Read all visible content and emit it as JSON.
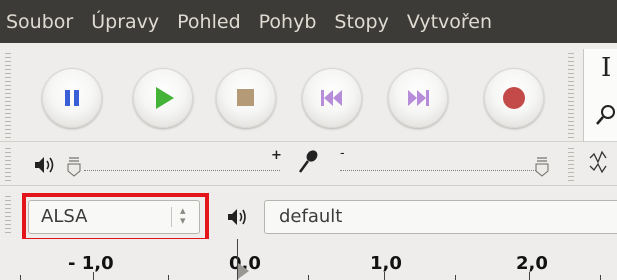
{
  "menu": {
    "items": [
      "Soubor",
      "Úpravy",
      "Pohled",
      "Pohyb",
      "Stopy",
      "Vytvořen"
    ]
  },
  "transport": {
    "buttons": [
      {
        "name": "pause-button",
        "icon": "pause-icon",
        "color": "#3a5fd6"
      },
      {
        "name": "play-button",
        "icon": "play-icon",
        "color": "#45b337"
      },
      {
        "name": "stop-button",
        "icon": "stop-icon",
        "color": "#b49a76"
      },
      {
        "name": "skip-to-start-button",
        "icon": "skip-start-icon",
        "color": "#b78cd8"
      },
      {
        "name": "skip-to-end-button",
        "icon": "skip-end-icon",
        "color": "#b78cd8"
      },
      {
        "name": "record-button",
        "icon": "record-icon",
        "color": "#c44a4a"
      }
    ]
  },
  "meters": {
    "playback_plus": "+",
    "recording_minus": "-"
  },
  "device": {
    "host_value": "ALSA",
    "output_value": "default",
    "highlight_color": "#e4141b"
  },
  "ruler": {
    "labels": [
      "- 1,0",
      "0,0",
      "1,0",
      "2,0"
    ]
  }
}
